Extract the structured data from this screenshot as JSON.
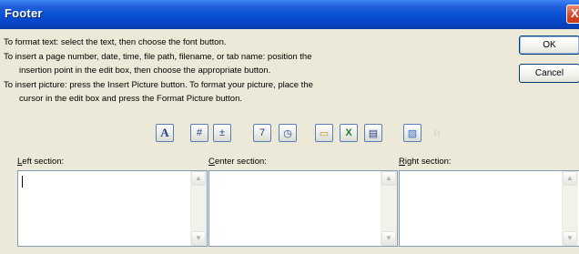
{
  "dialog": {
    "title": "Footer",
    "close_symbol": "X"
  },
  "instructions": {
    "line1": "To format text:  select the text, then choose the font button.",
    "line2": "To insert a page number, date, time, file path, filename, or tab name:  position the",
    "line3": "insertion point in the edit box, then choose the appropriate button.",
    "line4": "To insert picture: press the Insert Picture button.  To format your picture, place the",
    "line5": "cursor in the edit box and press the Format Picture button."
  },
  "buttons": {
    "ok": "OK",
    "cancel": "Cancel"
  },
  "toolbar": {
    "font": {
      "icon": "font-icon",
      "glyph": "A"
    },
    "page_number": {
      "icon": "page-number-icon",
      "glyph": "#"
    },
    "total_pages": {
      "icon": "total-pages-icon",
      "glyph": "±"
    },
    "date": {
      "icon": "date-icon",
      "glyph": "7"
    },
    "time": {
      "icon": "time-icon",
      "glyph": "◷"
    },
    "file_path": {
      "icon": "file-path-icon",
      "glyph": "▭"
    },
    "filename": {
      "icon": "filename-icon",
      "glyph": "X"
    },
    "sheet_name": {
      "icon": "sheet-name-icon",
      "glyph": "▤"
    },
    "insert_picture": {
      "icon": "insert-picture-icon",
      "glyph": "▧"
    },
    "format_picture": {
      "icon": "format-picture-icon",
      "glyph": "♘"
    }
  },
  "sections": {
    "left": {
      "label_underlined": "L",
      "label_rest": "eft section:",
      "value": ""
    },
    "center": {
      "label_underlined": "C",
      "label_rest": "enter section:",
      "value": ""
    },
    "right": {
      "label_underlined": "R",
      "label_rest": "ight section:",
      "value": ""
    }
  },
  "colors": {
    "titlebar": "#0a52d6",
    "dialog_background": "#ece9d8",
    "button_border": "#003c74",
    "close_button": "#d4482a"
  }
}
